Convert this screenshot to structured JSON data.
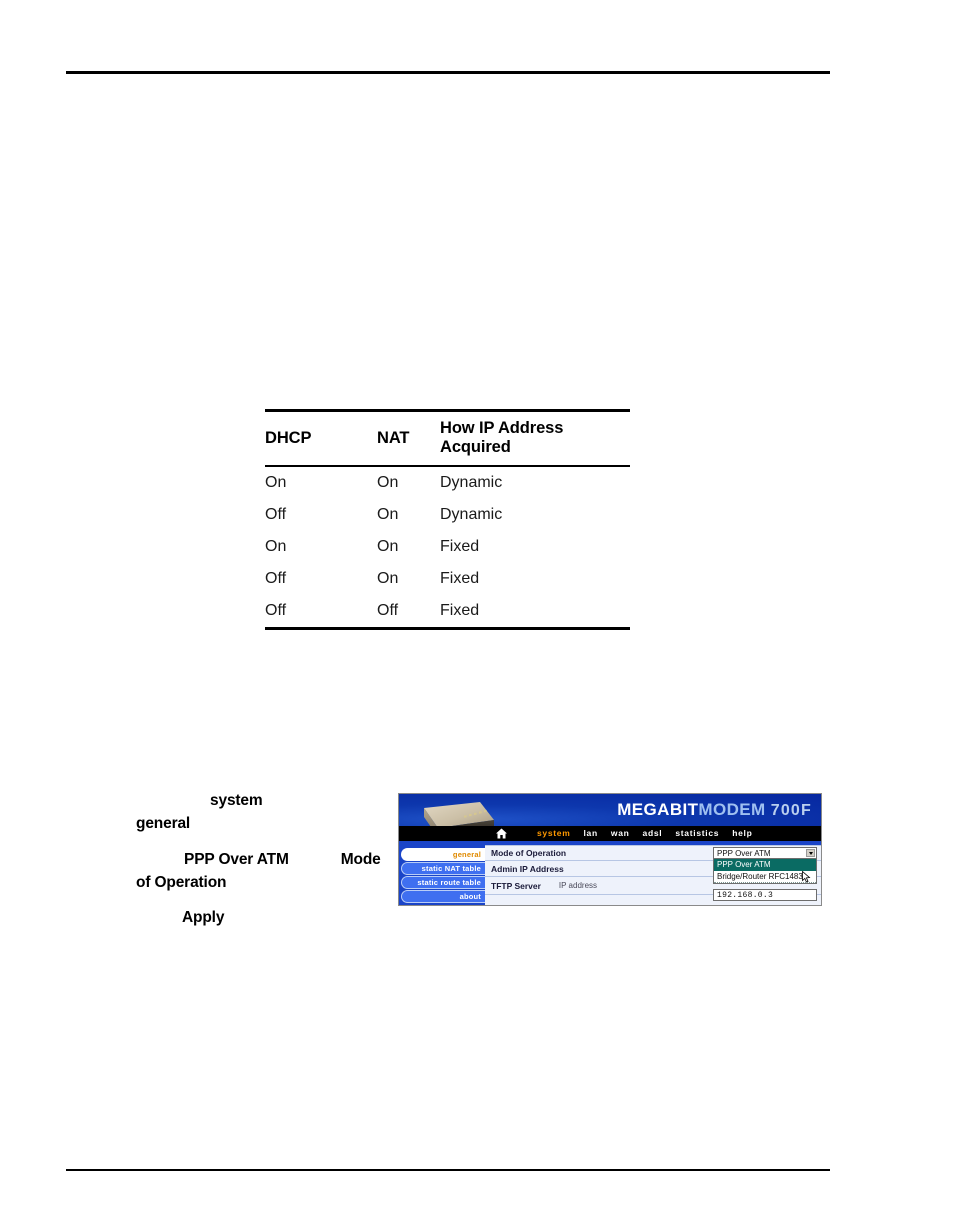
{
  "table": {
    "headers": [
      "DHCP",
      "NAT",
      "How IP Address Acquired"
    ],
    "rows": [
      [
        "On",
        "On",
        "Dynamic"
      ],
      [
        "Off",
        "On",
        "Dynamic"
      ],
      [
        "On",
        "On",
        "Fixed"
      ],
      [
        "Off",
        "On",
        "Fixed"
      ],
      [
        "Off",
        "Off",
        "Fixed"
      ]
    ]
  },
  "prose": {
    "line1_a": "system",
    "line1_b": "general",
    "line2_a": "PPP Over ATM",
    "line2_b": "Mode",
    "line2_c": "of Operation",
    "line3": "Apply"
  },
  "screenshot": {
    "brand": {
      "part1": "MEGABIT",
      "part2": "MODEM",
      "part3": "700F"
    },
    "nav": {
      "home_icon": "home-icon",
      "items": [
        {
          "label": "system",
          "active": true
        },
        {
          "label": "lan",
          "active": false
        },
        {
          "label": "wan",
          "active": false
        },
        {
          "label": "adsl",
          "active": false
        },
        {
          "label": "statistics",
          "active": false
        },
        {
          "label": "help",
          "active": false
        }
      ]
    },
    "sidebar": {
      "items": [
        {
          "label": "general",
          "active": true
        },
        {
          "label": "static NAT table",
          "active": false
        },
        {
          "label": "static route table",
          "active": false
        },
        {
          "label": "about",
          "active": false
        }
      ]
    },
    "form": {
      "rows": [
        {
          "label": "Mode of Operation",
          "sub": ""
        },
        {
          "label": "Admin IP Address",
          "sub": ""
        },
        {
          "label": "TFTP Server",
          "sub": "IP address"
        }
      ],
      "mode_select": {
        "value": "PPP Over ATM",
        "options": [
          {
            "label": "PPP Over ATM",
            "selected": true
          },
          {
            "label": "Bridge/Router RFC1483",
            "selected": false
          }
        ]
      },
      "tftp_ip": "192.168.0.3"
    },
    "colors": {
      "banner_blue": "#0d37ad",
      "nav_active": "#ff9900",
      "sidebar_blue": "#1a44c8",
      "dropdown_highlight": "#0a6b63",
      "form_bg": "#eef2fb"
    }
  }
}
